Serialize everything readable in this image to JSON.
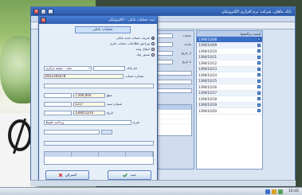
{
  "main_window": {
    "title": "بانک ماهان، شرکت ترم افزاری الکترونیکی",
    "tabs": [
      "مشخصات",
      "لیست"
    ]
  },
  "dialog": {
    "title": "ثبت عملیات بانکی - الکترونیکی",
    "tab_label": "عملیات بانکی",
    "radio_options": [
      "تعریف حساب جدید بانکی",
      "ویرایش اطلاعات حساب جاری",
      "انتقال وجه",
      "صدور چک"
    ],
    "fields": {
      "bank_label": "نام بانک",
      "bank_value": "ملت - شعبه مرکزی",
      "account_label": "شماره حساب",
      "account_value": "0012345678",
      "date_label": "تاریخ",
      "date_value": "1390/10/14",
      "amount_label": "مبلغ",
      "amount_value": "7,500,000",
      "doc_label": "شماره سند",
      "doc_value": "5217",
      "desc_label": "شرح",
      "desc_value": "پرداخت قسط"
    },
    "buttons": {
      "save": "ثبت",
      "cancel": "انصراف"
    }
  },
  "right_list": {
    "header": "لیست تراکنشها",
    "items": [
      "1390/10/08",
      "1390/10/09",
      "1390/10/10",
      "1390/10/11",
      "1390/10/12",
      "1390/10/13",
      "1390/10/14",
      "1390/10/15",
      "1390/10/16",
      "1390/10/17",
      "1390/10/18",
      "1390/10/19",
      "1390/10/20"
    ],
    "selected_index": 0
  },
  "middle": {
    "label_account": "حساب",
    "label_balance": "مانده",
    "label_from": "از تاریخ",
    "label_to": "تا تاریخ"
  },
  "taskbar": {
    "clock": "10:45"
  },
  "colors": {
    "title_blue": "#2a57a6",
    "selection": "#3b6fc8",
    "chip_red": "#d33",
    "chip_green": "#3a9a3a"
  }
}
